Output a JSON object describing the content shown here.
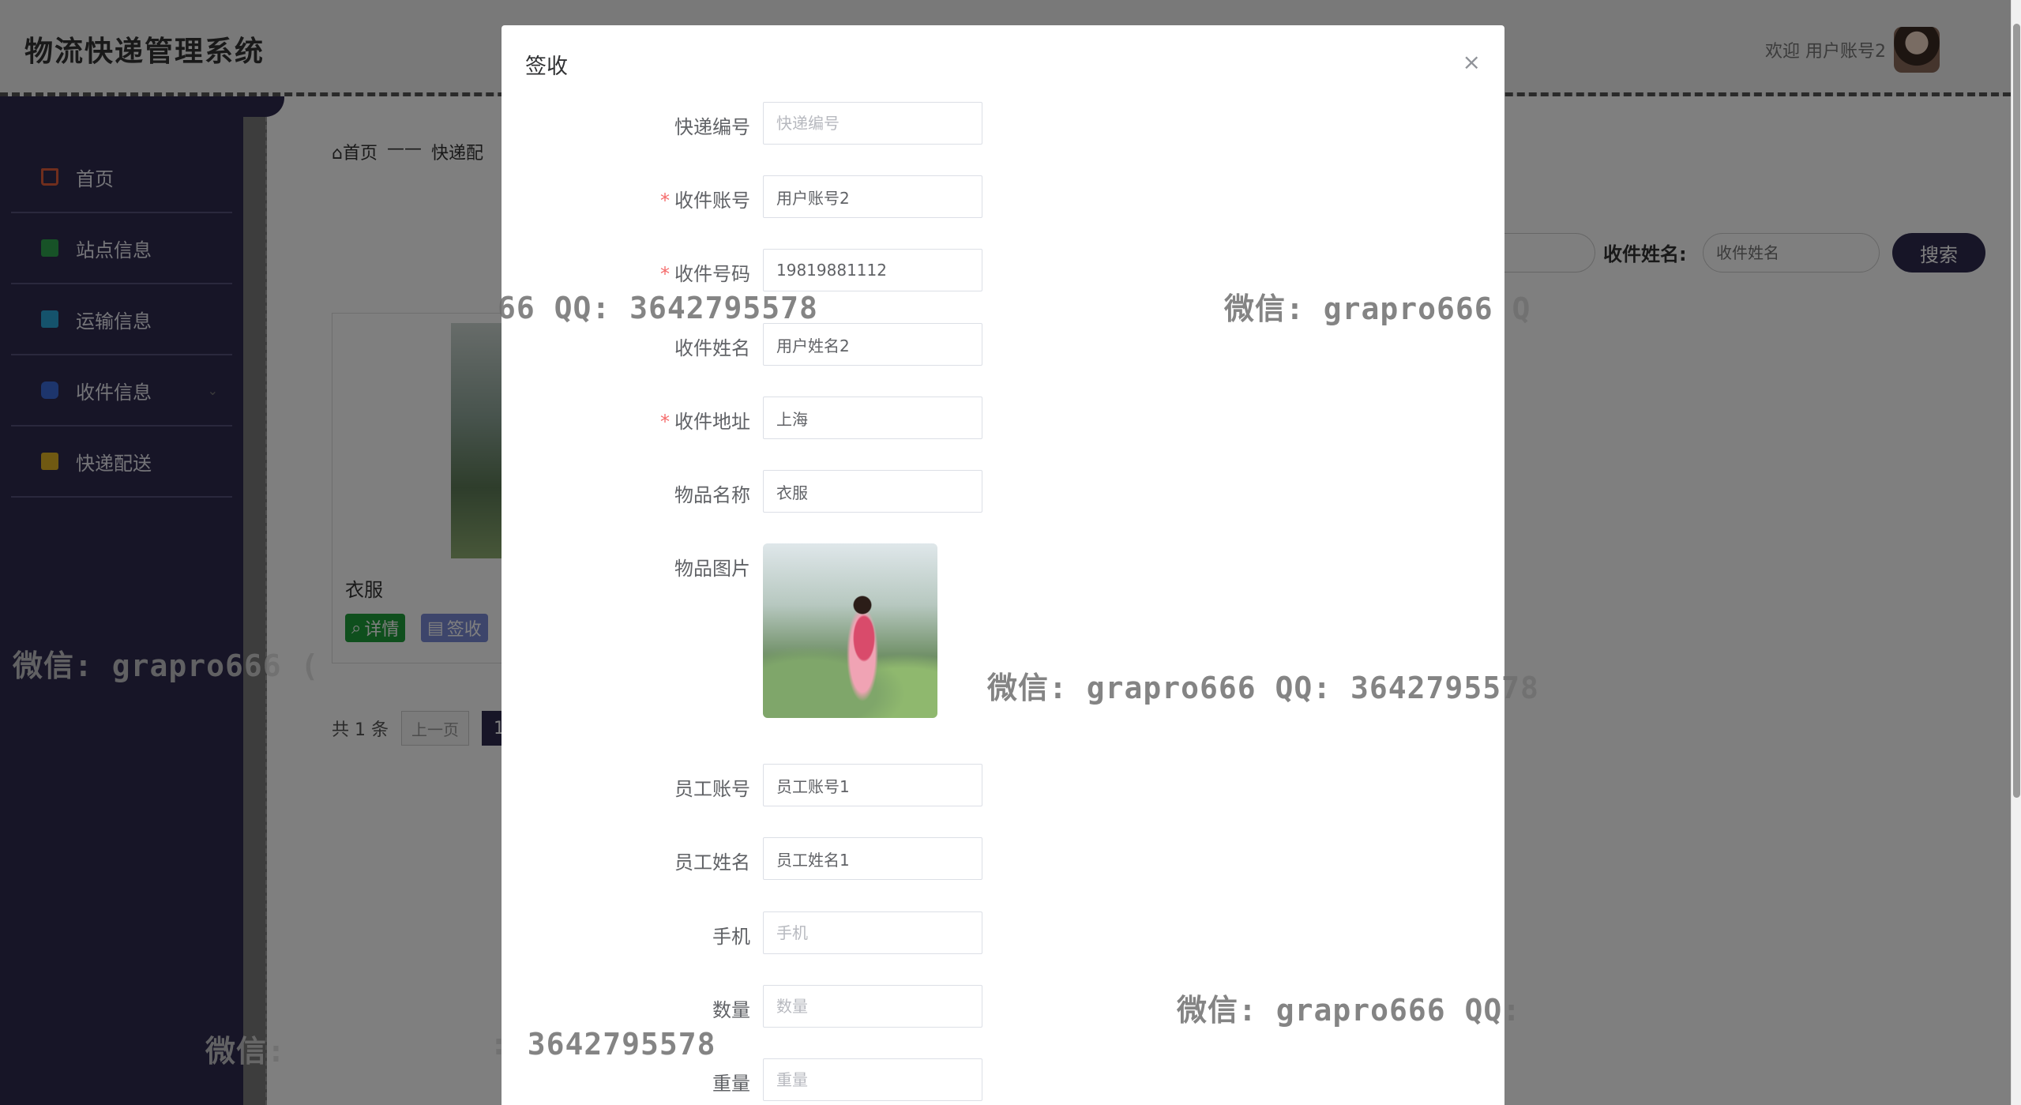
{
  "app": {
    "title": "物流快递管理系统",
    "welcome": "欢迎 用户账号2"
  },
  "sidebar": {
    "items": [
      {
        "label": "首页",
        "color": "#e05d3a"
      },
      {
        "label": "站点信息",
        "color": "#2ea44f"
      },
      {
        "label": "运输信息",
        "color": "#2aa7d8"
      },
      {
        "label": "收件信息",
        "color": "#3a6ad8"
      },
      {
        "label": "快递配送",
        "color": "#e0b325"
      }
    ]
  },
  "breadcrumb": {
    "home": "首页",
    "sep": "——",
    "current": "快递配"
  },
  "search": {
    "label": "收件姓名:",
    "placeholder": "收件姓名",
    "button": "搜索"
  },
  "card": {
    "name": "衣服",
    "detail_btn": "详情",
    "sign_btn": "签收"
  },
  "pager": {
    "total": "共 1 条",
    "prev": "上一页",
    "current": "1"
  },
  "dialog": {
    "title": "签收",
    "close": "×",
    "fields": [
      {
        "label": "快递编号",
        "required": false,
        "value": "",
        "placeholder": "快递编号"
      },
      {
        "label": "收件账号",
        "required": true,
        "value": "用户账号2",
        "placeholder": ""
      },
      {
        "label": "收件号码",
        "required": true,
        "value": "19819881112",
        "placeholder": ""
      },
      {
        "label": "收件姓名",
        "required": false,
        "value": "用户姓名2",
        "placeholder": ""
      },
      {
        "label": "收件地址",
        "required": true,
        "value": "上海",
        "placeholder": ""
      },
      {
        "label": "物品名称",
        "required": false,
        "value": "衣服",
        "placeholder": ""
      },
      {
        "label": "物品图片",
        "required": false,
        "value": null,
        "placeholder": ""
      },
      {
        "label": "员工账号",
        "required": false,
        "value": "员工账号1",
        "placeholder": ""
      },
      {
        "label": "员工姓名",
        "required": false,
        "value": "员工姓名1",
        "placeholder": ""
      },
      {
        "label": "手机",
        "required": false,
        "value": "",
        "placeholder": "手机"
      },
      {
        "label": "数量",
        "required": false,
        "value": "",
        "placeholder": "数量"
      },
      {
        "label": "重量",
        "required": false,
        "value": "",
        "placeholder": "重量"
      }
    ]
  },
  "watermarks": [
    "66 QQ: 3642795578",
    "微信: grapro666 Q",
    "微信: grapro666 (",
    "微信: grapro666 QQ: 3642795578",
    "微信: grapro666 QQ:",
    "微信:",
    ": 3642795578"
  ]
}
